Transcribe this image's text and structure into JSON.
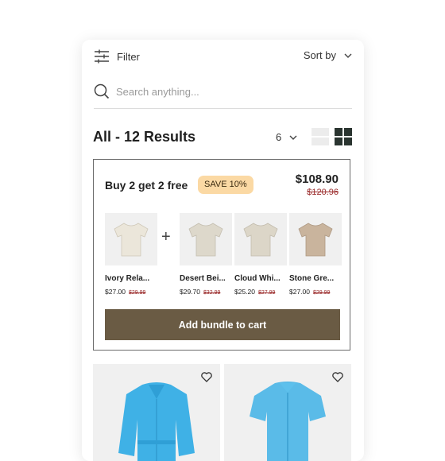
{
  "topbar": {
    "filter_label": "Filter",
    "sort_label": "Sort by"
  },
  "search": {
    "placeholder": "Search anything..."
  },
  "results": {
    "title": "All - 12 Results",
    "per_page": "6"
  },
  "bundle": {
    "title": "Buy 2 get 2 free",
    "badge": "SAVE 10%",
    "price": "$108.90",
    "old_price": "$120.96",
    "products": [
      {
        "name": "Ivory Rela...",
        "price": "$27.00",
        "old_price": "$29.99",
        "color": "#ebe6da"
      },
      {
        "name": "Desert Bei...",
        "price": "$29.70",
        "old_price": "$32.99",
        "color": "#ddd8cb"
      },
      {
        "name": "Cloud Whi...",
        "price": "$25.20",
        "old_price": "$27.99",
        "color": "#dcd6c8"
      },
      {
        "name": "Stone Gre...",
        "price": "$27.00",
        "old_price": "$29.99",
        "color": "#c9b49d"
      }
    ],
    "button_label": "Add bundle to cart"
  },
  "colors": {
    "accent": "#6a5b44",
    "badge_bg": "#fbd9a4",
    "strike": "#9b2c2c",
    "garment_blue": "#3fb1e6"
  }
}
